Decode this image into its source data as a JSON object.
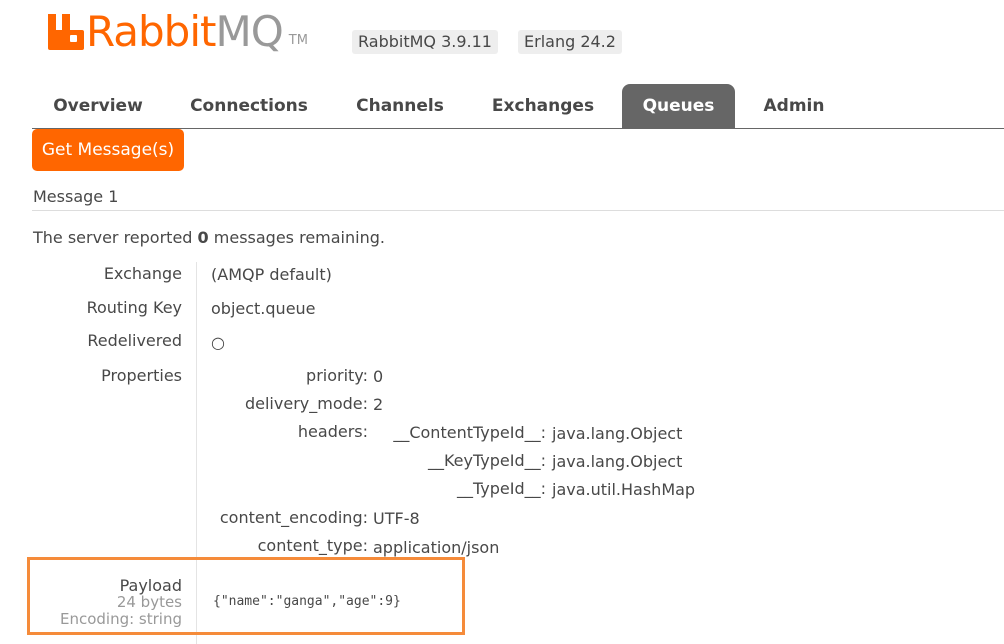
{
  "header": {
    "logo_rabbit": "Rabbit",
    "logo_mq": "MQ",
    "logo_tm": "TM",
    "version_label": "RabbitMQ 3.9.11",
    "erlang_label": "Erlang 24.2",
    "accent_color": "#ff6600"
  },
  "tabs": [
    {
      "label": "Overview",
      "active": false
    },
    {
      "label": "Connections",
      "active": false
    },
    {
      "label": "Channels",
      "active": false
    },
    {
      "label": "Exchanges",
      "active": false
    },
    {
      "label": "Queues",
      "active": true
    },
    {
      "label": "Admin",
      "active": false
    }
  ],
  "actions": {
    "get_messages_label": "Get Message(s)"
  },
  "message": {
    "title": "Message 1",
    "reported_prefix": "The server reported ",
    "remaining_count": "0",
    "reported_suffix": " messages remaining.",
    "fields": {
      "exchange_label": "Exchange",
      "exchange_value": "(AMQP default)",
      "routing_key_label": "Routing Key",
      "routing_key_value": "object.queue",
      "redelivered_label": "Redelivered",
      "redelivered_value": "○",
      "properties_label": "Properties"
    },
    "properties": {
      "priority_key": "priority:",
      "priority_value": "0",
      "delivery_mode_key": "delivery_mode:",
      "delivery_mode_value": "2",
      "headers_key": "headers:",
      "headers": [
        {
          "key": "__ContentTypeId__:",
          "value": "java.lang.Object"
        },
        {
          "key": "__KeyTypeId__:",
          "value": "java.lang.Object"
        },
        {
          "key": "__TypeId__:",
          "value": "java.util.HashMap"
        }
      ],
      "content_encoding_key": "content_encoding:",
      "content_encoding_value": "UTF-8",
      "content_type_key": "content_type:",
      "content_type_value": "application/json"
    },
    "payload": {
      "label": "Payload",
      "size": "24 bytes",
      "encoding": "Encoding: string",
      "value": "{\"name\":\"ganga\",\"age\":9}"
    }
  }
}
